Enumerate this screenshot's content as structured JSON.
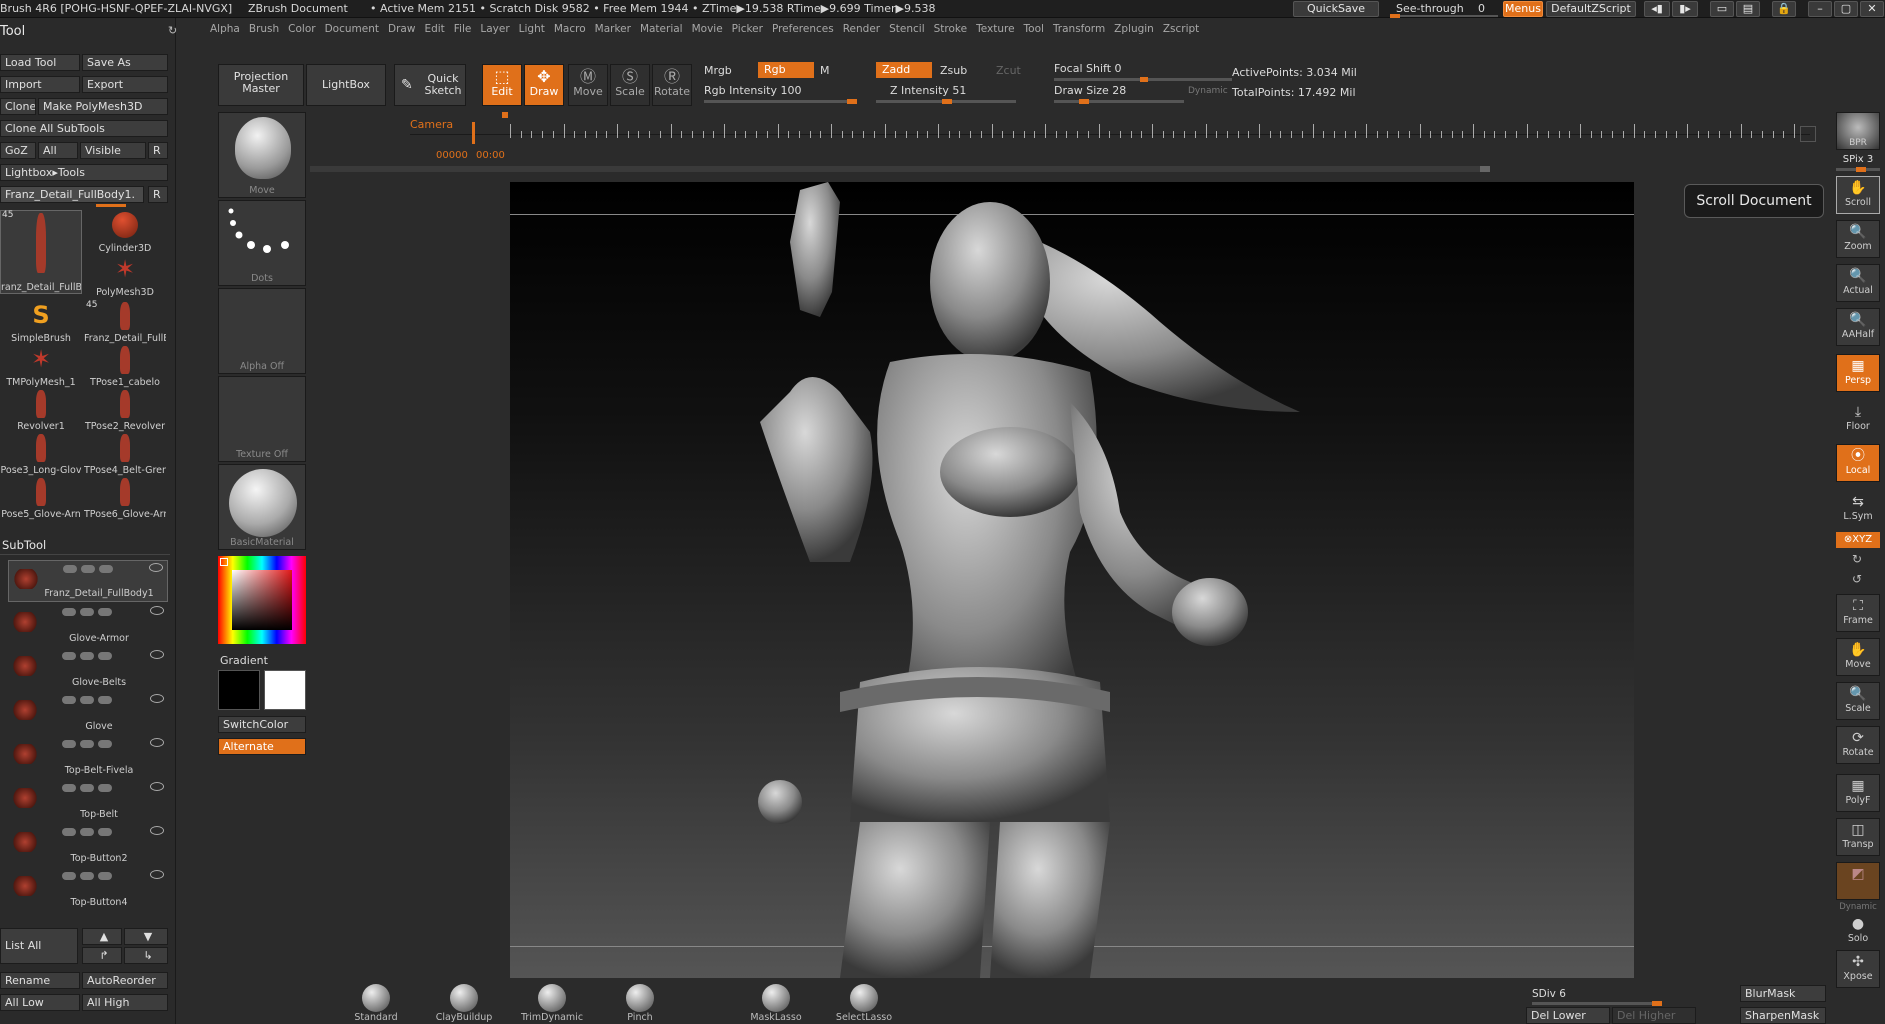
{
  "titlebar": {
    "app": "Brush 4R6 [POHG-HSNF-QPEF-ZLAI-NVGX]",
    "doc": "ZBrush Document",
    "stats": "• Active Mem 2151 • Scratch Disk 9582 • Free Mem 1944 • ZTime▶19.538 RTime▶9.699 Timer▶9.538",
    "quicksave": "QuickSave",
    "seethrough": "See-through",
    "seethrough_val": "0",
    "menus": "Menus",
    "defaultzscript": "DefaultZScript"
  },
  "menubar": [
    "Alpha",
    "Brush",
    "Color",
    "Document",
    "Draw",
    "Edit",
    "File",
    "Layer",
    "Light",
    "Macro",
    "Marker",
    "Material",
    "Movie",
    "Picker",
    "Preferences",
    "Render",
    "Stencil",
    "Stroke",
    "Texture",
    "Tool",
    "Transform",
    "Zplugin",
    "Zscript"
  ],
  "tool_panel": {
    "title": "Tool",
    "buttons": {
      "load_tool": "Load Tool",
      "save_as": "Save As",
      "import": "Import",
      "export": "Export",
      "clone": "Clone",
      "make_polymesh": "Make PolyMesh3D",
      "clone_all": "Clone All SubTools",
      "goz": "GoZ",
      "all": "All",
      "visible": "Visible",
      "r": "R",
      "lightbox_tools": "Lightbox▸Tools",
      "current_tool": "Franz_Detail_FullBody1.",
      "r2": "R"
    },
    "tool_count": "45",
    "tools": [
      {
        "name": "ranz_Detail_FullB"
      },
      {
        "name": "Cylinder3D"
      },
      {
        "name": "PolyMesh3D"
      },
      {
        "name": "SimpleBrush"
      },
      {
        "name": "Franz_Detail_FullB",
        "count": "45"
      },
      {
        "name": "TMPolyMesh_1"
      },
      {
        "name": "TPose1_cabelo"
      },
      {
        "name": "Revolver1"
      },
      {
        "name": "TPose2_Revolver"
      },
      {
        "name": "Pose3_Long-Glov"
      },
      {
        "name": "TPose4_Belt-Gren"
      },
      {
        "name": "Pose5_Glove-Arn"
      },
      {
        "name": "TPose6_Glove-Arn"
      }
    ],
    "subtool_title": "SubTool",
    "subtools": [
      "Franz_Detail_FullBody1",
      "Glove-Armor",
      "Glove-Belts",
      "Glove",
      "Top-Belt-Fivela",
      "Top-Belt",
      "Top-Button2",
      "Top-Button4"
    ],
    "list_all": "List All",
    "rename": "Rename",
    "autoreorder": "AutoReorder",
    "all_low": "All Low",
    "all_high": "All High"
  },
  "palette": {
    "move": "Move",
    "dots": "Dots",
    "alpha_off": "Alpha  Off",
    "texture_off": "Texture  Off",
    "basic_material": "BasicMaterial",
    "gradient": "Gradient",
    "switchcolor": "SwitchColor",
    "alternate": "Alternate"
  },
  "top_shelf": {
    "projection_master": "Projection Master",
    "lightbox": "LightBox",
    "quick_sketch": "Quick Sketch",
    "edit": "Edit",
    "draw": "Draw",
    "move": "Move",
    "scale": "Scale",
    "rotate": "Rotate",
    "mrgb": "Mrgb",
    "rgb": "Rgb",
    "m": "M",
    "rgb_intensity": "Rgb  Intensity 100",
    "zadd": "Zadd",
    "zsub": "Zsub",
    "zcut": "Zcut",
    "z_intensity": "Z Intensity 51",
    "focal_shift": "Focal  Shift 0",
    "draw_size": "Draw  Size 28",
    "dynamic": "Dynamic",
    "active_points": "ActivePoints: 3.034  Mil",
    "total_points": "TotalPoints: 17.492  Mil",
    "rgb_intensity_val": 100,
    "z_intensity_val": 51,
    "draw_size_val": 28
  },
  "timeline": {
    "camera": "Camera",
    "frame": "00000",
    "time": "00:00"
  },
  "tooltip": "Scroll Document",
  "right_shelf": {
    "bpr": "BPR",
    "spix": "SPix 3",
    "scroll": "Scroll",
    "zoom": "Zoom",
    "actual": "Actual",
    "aahalf": "AAHalf",
    "persp": "Persp",
    "floor": "Floor",
    "local": "Local",
    "lsym": "L.Sym",
    "xyz": "⊗XYZ",
    "frame": "Frame",
    "move": "Move",
    "scale": "Scale",
    "rotate": "Rotate",
    "polyf": "PolyF",
    "transp": "Transp",
    "dynamic": "Dynamic",
    "solo": "Solo",
    "xpose": "Xpose"
  },
  "bottom": {
    "brushes": [
      "Standard",
      "ClayBuildup",
      "TrimDynamic",
      "Pinch",
      "MaskLasso",
      "SelectLasso"
    ],
    "sdiv": "SDiv 6",
    "del_lower": "Del Lower",
    "del_higher": "Del Higher",
    "blurmask": "BlurMask",
    "sharpenmask": "SharpenMask"
  },
  "colors": {
    "accent": "#e0701a",
    "bg": "#2b2b2b",
    "panel": "#3a3a3a"
  }
}
